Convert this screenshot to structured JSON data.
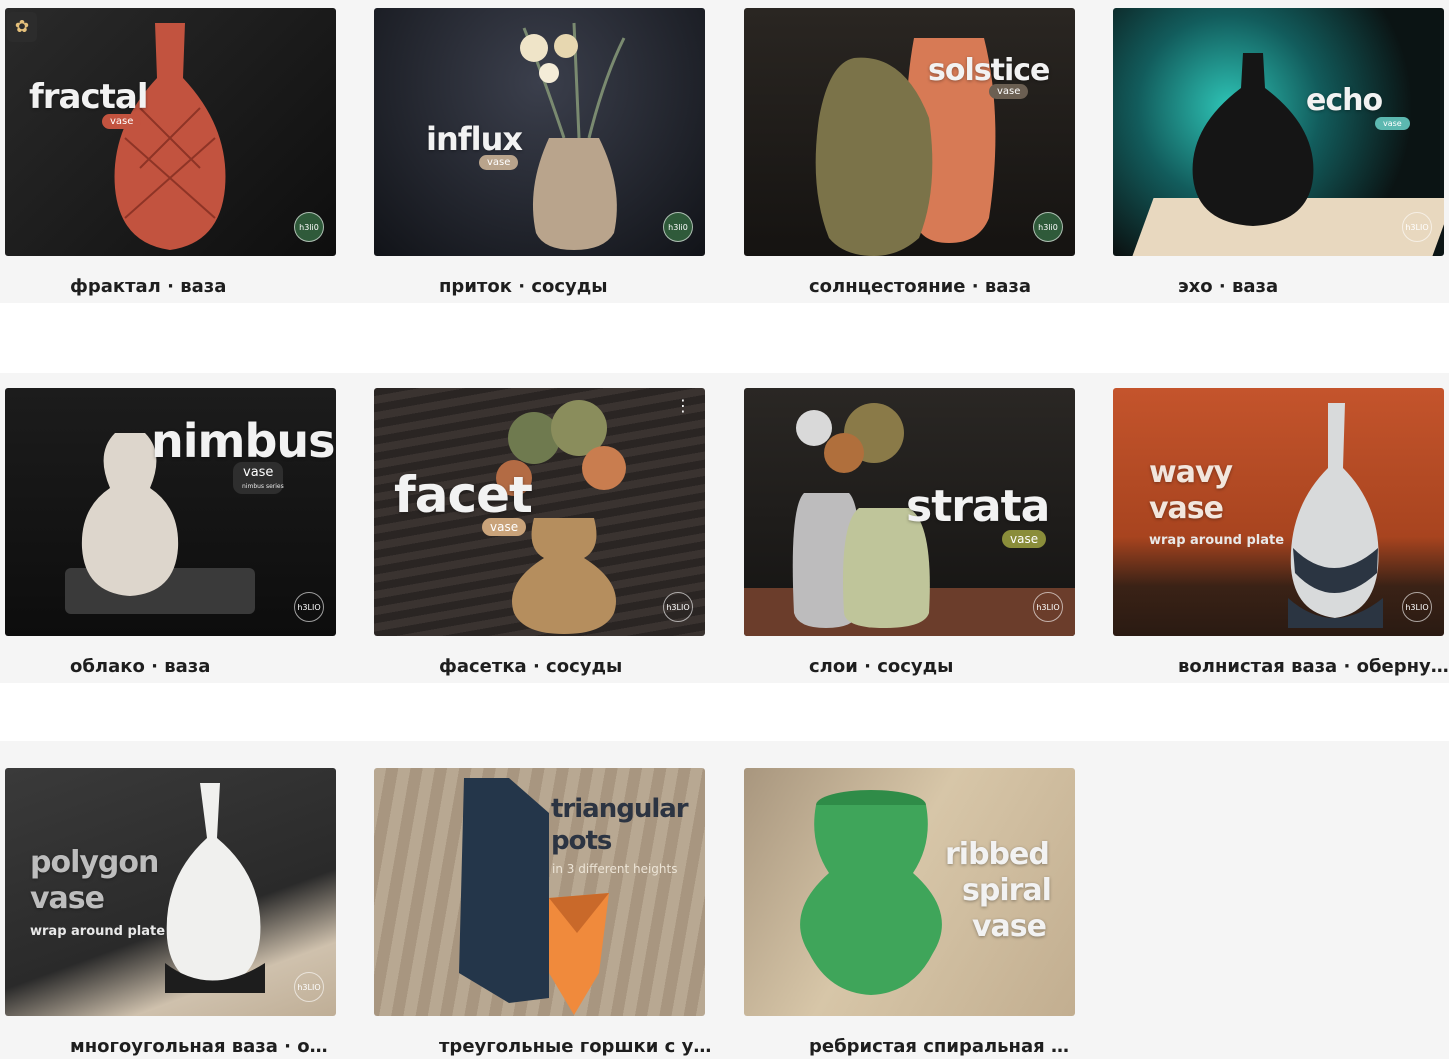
{
  "items": [
    {
      "thumb_title": "fractal",
      "thumb_pill": "vase",
      "thumb_brand": "h3li0",
      "caption": "фрактал · ваза"
    },
    {
      "thumb_title": "influx",
      "thumb_pill": "vase",
      "thumb_brand": "h3li0",
      "caption": "приток · сосуды"
    },
    {
      "thumb_title": "solstice",
      "thumb_pill": "vase",
      "thumb_brand": "h3li0",
      "caption": "солнцестояние · ваза"
    },
    {
      "thumb_title": "echo",
      "thumb_pill": "vase",
      "thumb_brand": "h3LIO",
      "caption": "эхо · ваза"
    },
    {
      "thumb_title": "nimbus",
      "thumb_pill": "vase",
      "thumb_pill_sub": "nimbus series",
      "thumb_brand": "h3LIO",
      "caption": "облако · ваза"
    },
    {
      "thumb_title": "facet",
      "thumb_pill": "vase",
      "thumb_brand": "h3LIO",
      "caption": "фасетка · сосуды"
    },
    {
      "thumb_title": "strata",
      "thumb_pill": "vase",
      "thumb_brand": "h3LIO",
      "caption": "слои · сосуды"
    },
    {
      "thumb_title_line1": "wavy",
      "thumb_title_line2": "vase",
      "thumb_sub": "wrap around plate",
      "thumb_brand": "h3LIO",
      "caption": "волнистая ваза · обернутая вокруг тарелки"
    },
    {
      "thumb_title_line1": "polygon",
      "thumb_title_line2": "vase",
      "thumb_sub": "wrap around plate",
      "thumb_brand": "h3LIO",
      "caption": "многоугольная ваза · обернутая вокруг тарелки"
    },
    {
      "thumb_title_line1": "triangular",
      "thumb_title_line2": "pots",
      "thumb_sub": "in 3 different heights",
      "caption": "треугольные горшки с узором"
    },
    {
      "thumb_title_line1": "ribbed",
      "thumb_title_line2": "spiral",
      "thumb_title_line3": "vase",
      "caption": "ребристая спиральная ваза"
    }
  ],
  "icons": {
    "badge": "award-badge-icon",
    "more": "more-vertical-icon"
  },
  "colors": {
    "page_bg": "#f5f5f5",
    "caption_text": "#1e1e1e",
    "fractal_vase": "#c2533f",
    "influx_vase": "#b9a48c",
    "solstice_vase_green": "#7b7349",
    "solstice_vase_orange": "#d77a55",
    "echo_glow": "#2ec4b6",
    "wavy_bg": "#c4542c",
    "ribbed_green": "#3fa55a",
    "tri_orange": "#f08a3c",
    "tri_navy": "#24364a"
  }
}
